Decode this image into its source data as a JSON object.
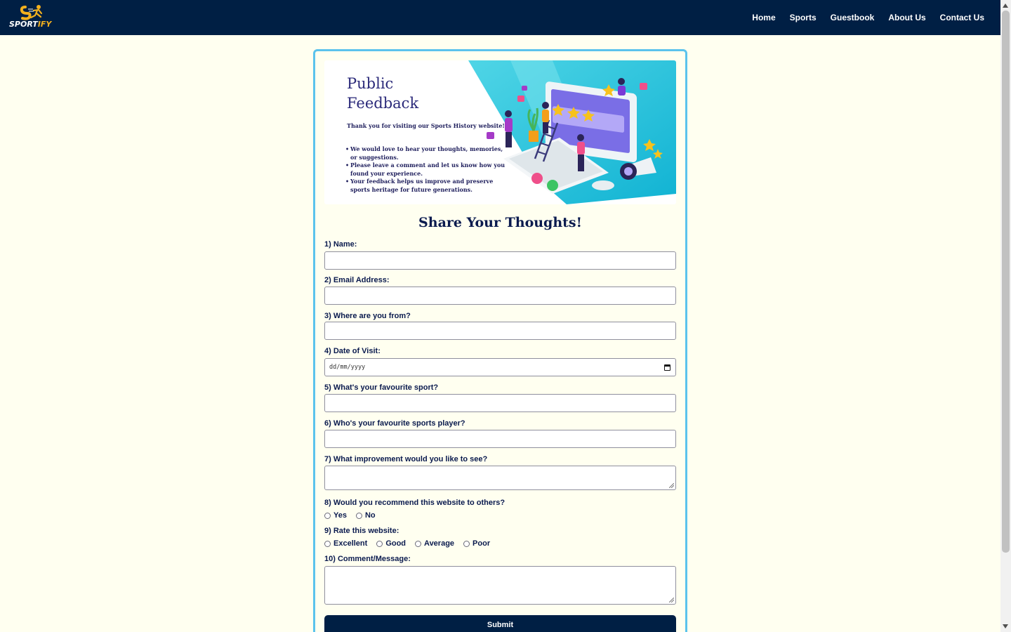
{
  "brand": {
    "logo_text_a": "SPORT",
    "logo_text_b": "IFY"
  },
  "nav": {
    "links": [
      {
        "label": "Home"
      },
      {
        "label": "Sports"
      },
      {
        "label": "Guestbook"
      },
      {
        "label": "About Us"
      },
      {
        "label": "Contact Us"
      }
    ]
  },
  "banner": {
    "title_line1": "Public",
    "title_line2": "Feedback",
    "thanks": "Thank you for visiting our Sports History website!",
    "bullets": [
      "We would love to hear your thoughts, memories, or suggestions.",
      "Please leave a comment and let us know how you found your experience.",
      "Your feedback helps us improve and preserve sports heritage for future generations."
    ]
  },
  "form": {
    "heading": "Share Your Thoughts!",
    "q1": "1) Name:",
    "q2": "2) Email Address:",
    "q3": "3) Where are you from?",
    "q4": "4) Date of Visit:",
    "q4_placeholder": "dd/mm/yyyy",
    "q5": "5) What's your favourite sport?",
    "q6": "6) Who's your favourite sports player?",
    "q7": "7) What improvement would you like to see?",
    "q8": "8) Would you recommend this website to others?",
    "q8_options": [
      "Yes",
      "No"
    ],
    "q9": "9) Rate this website:",
    "q9_options": [
      "Excellent",
      "Good",
      "Average",
      "Poor"
    ],
    "q10": "10) Comment/Message:",
    "submit_label": "Submit"
  },
  "colors": {
    "navbar": "#001f44",
    "page_bg": "#fffff0",
    "card_border": "#5bc3ec",
    "heading": "#0a1a4e"
  }
}
